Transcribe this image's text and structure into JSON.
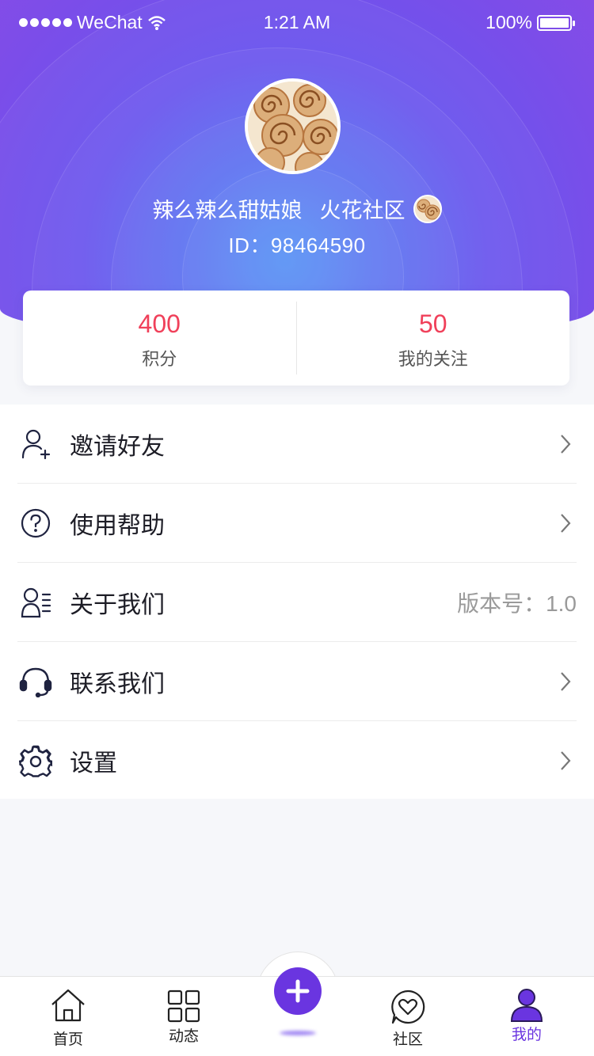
{
  "status_bar": {
    "carrier": "WeChat",
    "time": "1:21 AM",
    "battery": "100%"
  },
  "profile": {
    "nickname": "辣么辣么甜姑娘",
    "community": "火花社区",
    "id_label": "ID：98464590"
  },
  "stats": [
    {
      "value": "400",
      "label": "积分"
    },
    {
      "value": "50",
      "label": "我的关注"
    }
  ],
  "menu": [
    {
      "label": "邀请好友",
      "icon": "add-user-icon"
    },
    {
      "label": "使用帮助",
      "icon": "help-icon"
    },
    {
      "label": "关于我们",
      "icon": "about-icon",
      "note": "版本号：1.0"
    },
    {
      "label": "联系我们",
      "icon": "headset-icon"
    },
    {
      "label": "设置",
      "icon": "gear-icon"
    }
  ],
  "tabs": [
    {
      "label": "首页",
      "icon": "home-icon"
    },
    {
      "label": "动态",
      "icon": "grid-icon"
    },
    {
      "label": "社区",
      "icon": "community-heart-icon"
    },
    {
      "label": "我的",
      "icon": "user-icon",
      "active": true
    }
  ],
  "colors": {
    "accent": "#6a35e0",
    "stat_number": "#f0405a",
    "hero_start": "#4e8cf5",
    "hero_end": "#8a4ce6"
  }
}
